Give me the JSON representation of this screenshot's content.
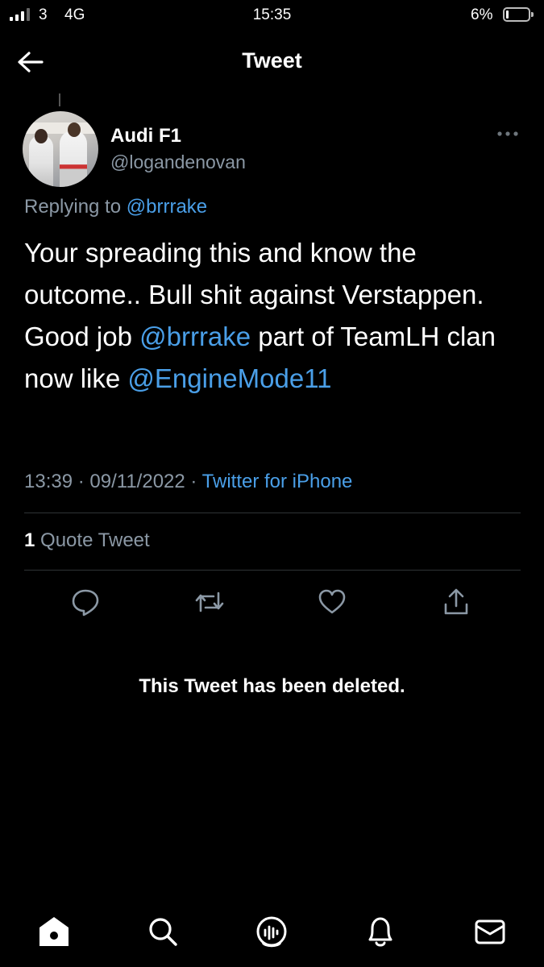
{
  "status_bar": {
    "carrier": "3",
    "network": "4G",
    "time": "15:35",
    "battery": "6%"
  },
  "header": {
    "title": "Tweet",
    "back_icon": "arrow-left-icon"
  },
  "tweet": {
    "display_name": "Audi F1",
    "handle": "@logandenovan",
    "replying_prefix": "Replying to",
    "replying_to": "@brrrake",
    "text_1": "Your spreading this and know the outcome.. Bull shit against Verstappen. Good job ",
    "mention_1": "@brrrake",
    "text_2": " part of TeamLH clan now like ",
    "mention_2": "@EngineMode11",
    "time": "13:39",
    "date": "09/11/2022",
    "source": "Twitter for iPhone",
    "quote_count": "1",
    "quote_label": "Quote Tweet"
  },
  "actions": [
    "reply-icon",
    "retweet-icon",
    "like-icon",
    "share-icon"
  ],
  "deleted_notice": "This Tweet has been deleted.",
  "tab_bar": [
    "home-icon",
    "search-icon",
    "spaces-icon",
    "notifications-icon",
    "messages-icon"
  ],
  "colors": {
    "background": "#000000",
    "link": "#4a9fe8",
    "secondary_text": "#8b98a5"
  }
}
